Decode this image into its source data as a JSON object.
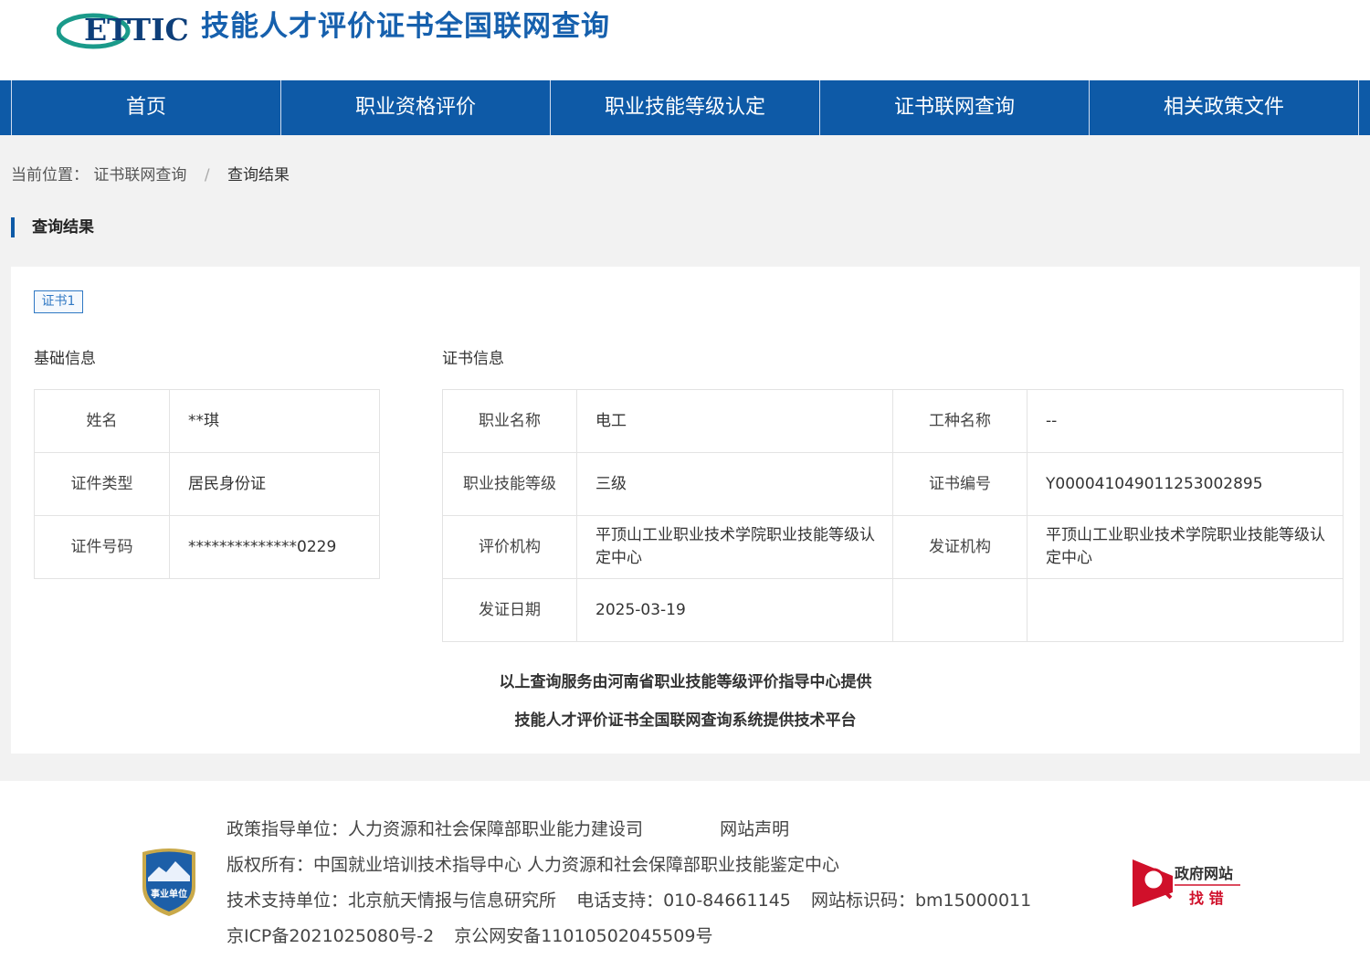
{
  "header": {
    "logo_text": "ETTIC",
    "site_title": "技能人才评价证书全国联网查询"
  },
  "nav": {
    "items": [
      {
        "label": "首页"
      },
      {
        "label": "职业资格评价"
      },
      {
        "label": "职业技能等级认定"
      },
      {
        "label": "证书联网查询"
      },
      {
        "label": "相关政策文件"
      }
    ]
  },
  "breadcrumb": {
    "prefix": "当前位置：",
    "link": "证书联网查询",
    "separator": "/",
    "current": "查询结果"
  },
  "section_title": "查询结果",
  "result": {
    "cert_tab": "证书1",
    "basic_label": "基础信息",
    "cert_label": "证书信息",
    "basic": {
      "name_label": "姓名",
      "name_value": "**琪",
      "idtype_label": "证件类型",
      "idtype_value": "居民身份证",
      "idno_label": "证件号码",
      "idno_value": "**************0229"
    },
    "cert": {
      "occupation_label": "职业名称",
      "occupation_value": "电工",
      "worktype_label": "工种名称",
      "worktype_value": "--",
      "level_label": "职业技能等级",
      "level_value": "三级",
      "certno_label": "证书编号",
      "certno_value": "Y000041049011253002895",
      "evaluator_label": "评价机构",
      "evaluator_value": "平顶山工业职业技术学院职业技能等级认定中心",
      "issuer_label": "发证机构",
      "issuer_value": "平顶山工业职业技术学院职业技能等级认定中心",
      "date_label": "发证日期",
      "date_value": "2025-03-19"
    },
    "provider_line1": "以上查询服务由河南省职业技能等级评价指导中心提供",
    "provider_line2": "技能人才评价证书全国联网查询系统提供技术平台"
  },
  "footer": {
    "badge_text": "事业单位",
    "policy": "政策指导单位：人力资源和社会保障部职业能力建设司",
    "statement": "网站声明",
    "copyright": "版权所有：中国就业培训技术指导中心    人力资源和社会保障部职业技能鉴定中心",
    "support": "技术支持单位：北京航天情报与信息研究所",
    "phone": "电话支持：010-84661145",
    "site_id": "网站标识码：bm15000011",
    "icp": "京ICP备2021025080号-2",
    "police": "京公网安备11010502045509号",
    "gov_line1": "政府网站",
    "gov_line2": "找 错"
  },
  "colors": {
    "brand_blue": "#0e5aa7",
    "title_blue": "#1660ad",
    "logo_green": "#1a9a8a",
    "gov_red": "#d0102a"
  }
}
